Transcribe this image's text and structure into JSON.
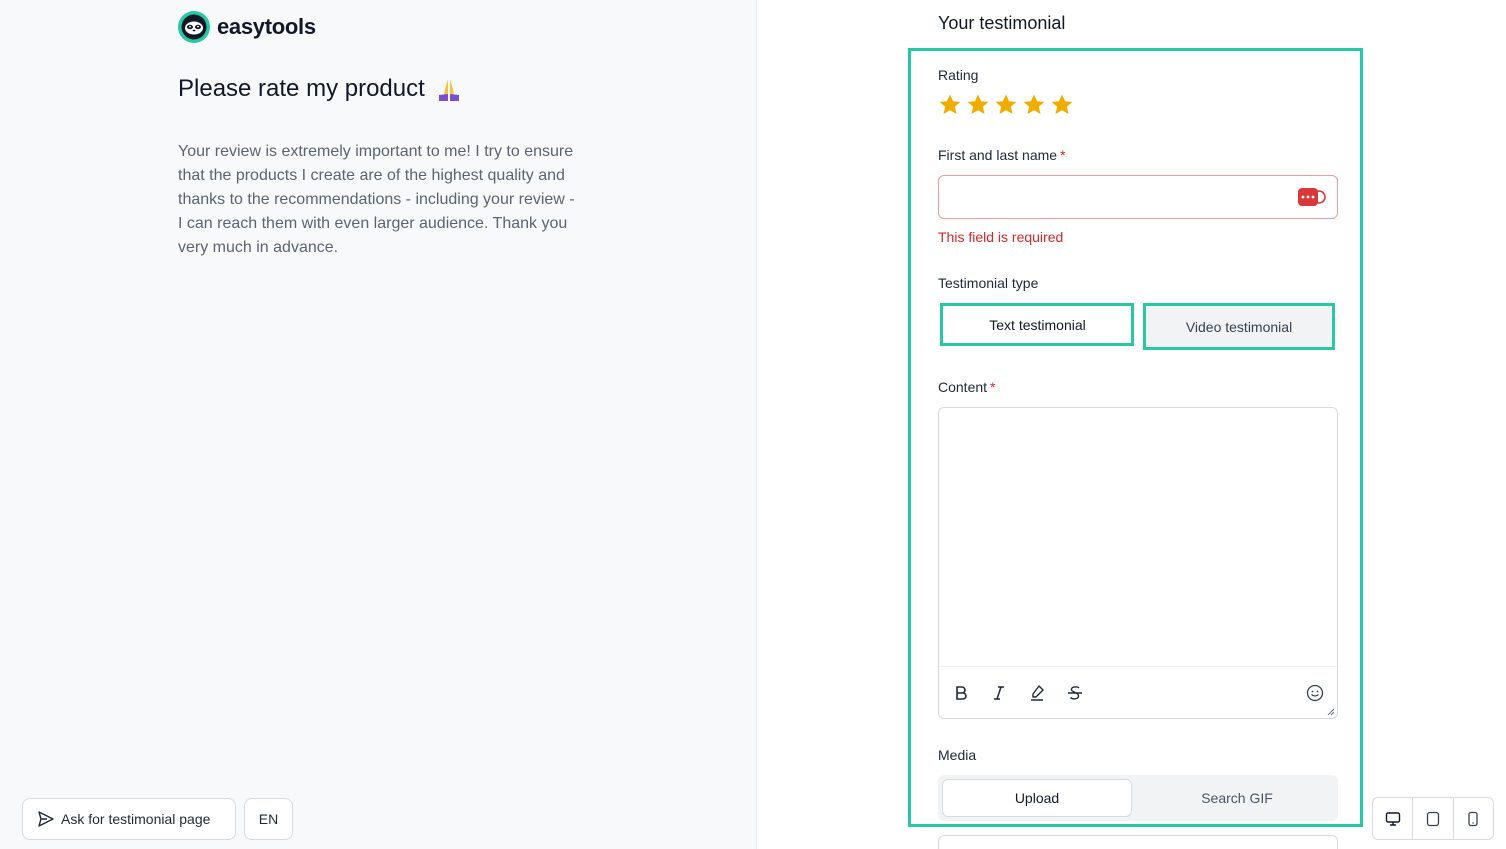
{
  "brand": {
    "name": "easytools",
    "color": "#26c9a3"
  },
  "intro": {
    "heading": "Please rate my product",
    "heading_icon": "folded-hands-icon",
    "description": "Your review is extremely important to me! I try to ensure that the products I create are of the highest quality and thanks to the recommendations - including your review - I can reach them with even larger audience. Thank you very much in advance."
  },
  "footer": {
    "ask_button_label": "Ask for testimonial page",
    "language_label": "EN"
  },
  "form": {
    "title": "Your testimonial",
    "rating": {
      "label": "Rating",
      "value": 5,
      "max": 5,
      "star_color": "#f0ad00"
    },
    "name": {
      "label": "First and last name",
      "required_mark": "*",
      "value": "",
      "error": "This field is required"
    },
    "testimonial_type": {
      "label": "Testimonial type",
      "options": [
        "Text testimonial",
        "Video testimonial"
      ],
      "selected": "Text testimonial"
    },
    "content": {
      "label": "Content",
      "required_mark": "*",
      "value": ""
    },
    "media": {
      "label": "Media",
      "tabs": [
        "Upload",
        "Search GIF"
      ],
      "selected": "Upload"
    }
  },
  "colors": {
    "error": "#dc2626",
    "highlight": "#26c9a3"
  }
}
